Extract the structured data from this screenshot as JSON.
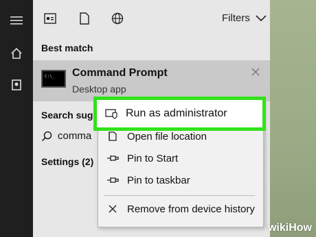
{
  "sidebar": {
    "icons": [
      "hamburger-icon",
      "home-icon",
      "user-icon"
    ]
  },
  "toolbar": {
    "filters_label": "Filters",
    "icons": [
      "apps-icon",
      "document-icon",
      "web-icon"
    ]
  },
  "best_match": {
    "title": "Best match",
    "item_title": "Command Prompt",
    "item_subtitle": "Desktop app"
  },
  "search_suggestions": {
    "title": "Search sugge",
    "query_text": "comma"
  },
  "settings": {
    "title": "Settings (2)"
  },
  "context_menu": {
    "items": [
      {
        "label": "Run as administrator",
        "icon": "shield-icon"
      },
      {
        "label": "Open file location",
        "icon": "folder-icon"
      },
      {
        "label": "Pin to Start",
        "icon": "pin-icon"
      },
      {
        "label": "Pin to taskbar",
        "icon": "pin-icon"
      },
      {
        "label": "Remove from device history",
        "icon": "close-icon"
      }
    ],
    "highlight_color": "#31e21b"
  },
  "watermark": {
    "text": "wikiHow"
  }
}
